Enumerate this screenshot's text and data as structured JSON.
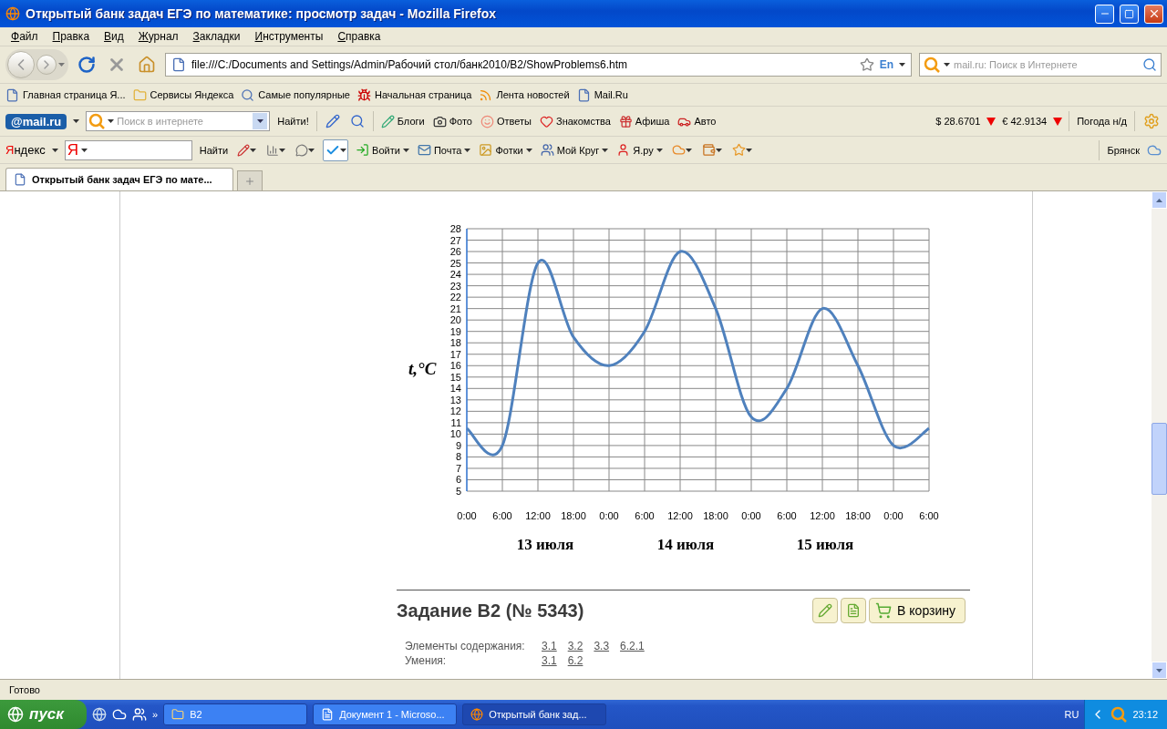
{
  "window": {
    "title": "Открытый банк задач ЕГЭ по математике: просмотр задач - Mozilla Firefox"
  },
  "menu": [
    "Файл",
    "Правка",
    "Вид",
    "Журнал",
    "Закладки",
    "Инструменты",
    "Справка"
  ],
  "nav": {
    "url": "file:///C:/Documents and Settings/Admin/Рабочий стол/банк2010/B2/ShowProblems6.htm",
    "lang": "En",
    "search_placeholder": "mail.ru: Поиск в Интернете"
  },
  "bookmarks": [
    "Главная страница Я...",
    "Сервисы Яндекса",
    "Самые популярные",
    "Начальная страница",
    "Лента новостей",
    "Mail.Ru"
  ],
  "mail_toolbar": {
    "logo": "@mail.ru",
    "search_placeholder": "Поиск в интернете",
    "find": "Найти!",
    "items": [
      "Блоги",
      "Фото",
      "Ответы",
      "Знакомства",
      "Афиша",
      "Авто"
    ],
    "rates": [
      "$ 28.6701",
      "€ 42.9134"
    ],
    "weather": "Погода н/д"
  },
  "yandex_toolbar": {
    "logo": "Яндекс",
    "field_logo": "Я",
    "find": "Найти",
    "items": [
      "Войти",
      "Почта",
      "Фотки",
      "Мой Круг",
      "Я.ру"
    ],
    "city": "Брянск"
  },
  "tabs": [
    {
      "label": "Открытый банк задач ЕГЭ по мате...",
      "selected": true
    }
  ],
  "chart": {
    "day_labels": [
      "13 июля",
      "14 июля",
      "15 июля"
    ],
    "chart_data": {
      "type": "line",
      "ylabel": "t,°C",
      "grid": true,
      "categories": [
        "0:00",
        "6:00",
        "12:00",
        "18:00",
        "0:00",
        "6:00",
        "12:00",
        "18:00",
        "0:00",
        "6:00",
        "12:00",
        "18:00",
        "0:00",
        "6:00"
      ],
      "series": [
        {
          "color": "#4f81bd",
          "values": [
            10.5,
            9,
            25,
            18.5,
            16,
            19,
            26,
            21,
            11.5,
            14,
            21,
            16,
            9,
            10.5
          ]
        }
      ],
      "ylim": [
        5,
        28
      ],
      "yticks": [
        5,
        6,
        7,
        8,
        9,
        10,
        11,
        12,
        13,
        14,
        15,
        16,
        17,
        18,
        19,
        20,
        21,
        22,
        23,
        24,
        25,
        26,
        27,
        28
      ]
    }
  },
  "problem": {
    "title": "Задание B2 (№ 5343)",
    "cart_button": "В корзину",
    "rows": [
      {
        "label": "Элементы содержания:",
        "links": [
          "3.1",
          "3.2",
          "3.3",
          "6.2.1"
        ]
      },
      {
        "label": "Умения:",
        "links": [
          "3.1",
          "6.2"
        ]
      }
    ]
  },
  "status": "Готово",
  "taskbar": {
    "start": "пуск",
    "more": "»",
    "items": [
      {
        "label": "B2",
        "selected": false
      },
      {
        "label": "Документ 1 - Microso...",
        "selected": false
      },
      {
        "label": "Открытый банк зад...",
        "selected": true
      }
    ],
    "lang": "RU",
    "clock": "23:12"
  }
}
